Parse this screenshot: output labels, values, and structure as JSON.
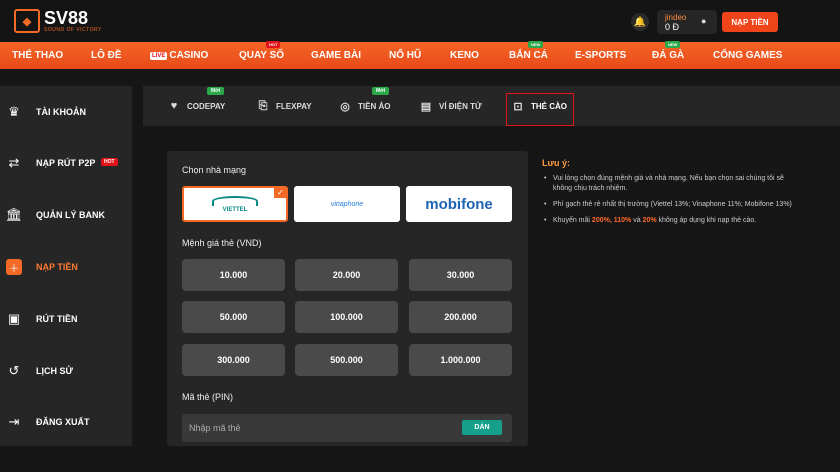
{
  "header": {
    "logo_text": "SV88",
    "logo_tagline": "SOUND OF VICTORY",
    "username": "jindeo",
    "balance": "0 Đ",
    "deposit_button": "NẠP TIỀN"
  },
  "nav": {
    "items": [
      {
        "label": "THỂ THAO"
      },
      {
        "label": "LÔ ĐỀ"
      },
      {
        "label": "CASINO",
        "prefix": "LIVE"
      },
      {
        "label": "QUAY SỐ",
        "badge": "HOT"
      },
      {
        "label": "GAME BÀI"
      },
      {
        "label": "NỔ HŨ"
      },
      {
        "label": "KENO"
      },
      {
        "label": "BẮN CÁ",
        "badge": "NEW"
      },
      {
        "label": "E-SPORTS"
      },
      {
        "label": "ĐÁ GÀ",
        "badge": "NEW"
      },
      {
        "label": "CỔNG GAMES"
      }
    ]
  },
  "sidebar": {
    "items": [
      {
        "label": "TÀI KHOẢN",
        "icon": "crown-icon"
      },
      {
        "label": "NẠP RÚT P2P",
        "icon": "p2p-exchange-icon",
        "badge": "HOT"
      },
      {
        "label": "QUẢN LÝ BANK",
        "icon": "bank-icon"
      },
      {
        "label": "NẠP TIỀN",
        "icon": "wallet-add-icon",
        "active": true
      },
      {
        "label": "RÚT TIỀN",
        "icon": "cash-withdraw-icon"
      },
      {
        "label": "LỊCH SỬ",
        "icon": "history-icon"
      },
      {
        "label": "ĐĂNG XUẤT",
        "icon": "logout-icon"
      }
    ]
  },
  "tabs": {
    "items": [
      {
        "label": "CODEPAY",
        "badge": "Mới",
        "icon": "codepay-icon"
      },
      {
        "label": "FLEXPAY",
        "icon": "flexpay-icon"
      },
      {
        "label": "TIỀN ẢO",
        "badge": "Mới",
        "icon": "crypto-coin-icon"
      },
      {
        "label": "VÍ ĐIỆN TỬ",
        "icon": "e-wallet-icon"
      },
      {
        "label": "THẺ CÀO",
        "icon": "scratch-card-icon",
        "active": true
      }
    ]
  },
  "form": {
    "provider_label": "Chọn nhà mạng",
    "providers": [
      {
        "name": "VIETTEL",
        "selected": true
      },
      {
        "name": "vinaphone",
        "selected": false
      },
      {
        "name": "mobifone",
        "selected": false
      }
    ],
    "denomination_label": "Mệnh giá thẻ (VND)",
    "denominations": [
      "10.000",
      "20.000",
      "30.000",
      "50.000",
      "100.000",
      "200.000",
      "300.000",
      "500.000",
      "1.000.000"
    ],
    "pin_label": "Mã thẻ (PIN)",
    "pin_placeholder": "Nhập mã thẻ",
    "pin_value": "",
    "paste_button": "DÁN"
  },
  "notes": {
    "title": "Lưu ý:",
    "items": [
      "Vui lòng chọn đúng mệnh giá và nhà mạng. Nếu bạn chọn sai chúng tôi sẽ",
      "không chịu trách nhiệm.",
      "Phí gạch thẻ rẻ nhất thị trường (Viettel 13%; Vinaphone 11%; Mobifone 13%)",
      "Khuyến mãi",
      "200%, 110%",
      "và",
      "20%",
      "không áp dụng khi nạp thẻ cào."
    ]
  },
  "colors": {
    "accent": "#f36a27",
    "nav_bg": "#ee5420",
    "panel_bg": "#262626",
    "paste_btn": "#14a08a"
  }
}
